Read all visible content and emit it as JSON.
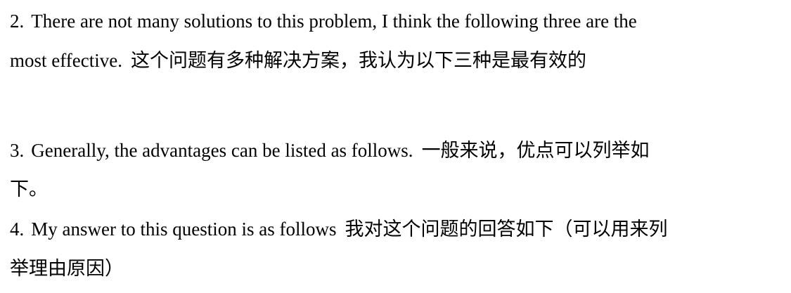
{
  "items": [
    {
      "number": "2.",
      "en_line1": "There are not many solutions to this problem, I think the following three are the",
      "en_line2": "most effective.",
      "zh_line2": "这个问题有多种解决方案，我认为以下三种是最有效的"
    },
    {
      "number": "3.",
      "en_line1": "Generally, the advantages can be listed as follows.",
      "zh_line1": "一般来说，优点可以列举如",
      "zh_line2": "下。"
    },
    {
      "number": "4.",
      "en_line1": "My answer to this question is as follows",
      "zh_line1": "我对这个问题的回答如下（可以用来列",
      "zh_line2": "举理由原因）"
    }
  ]
}
